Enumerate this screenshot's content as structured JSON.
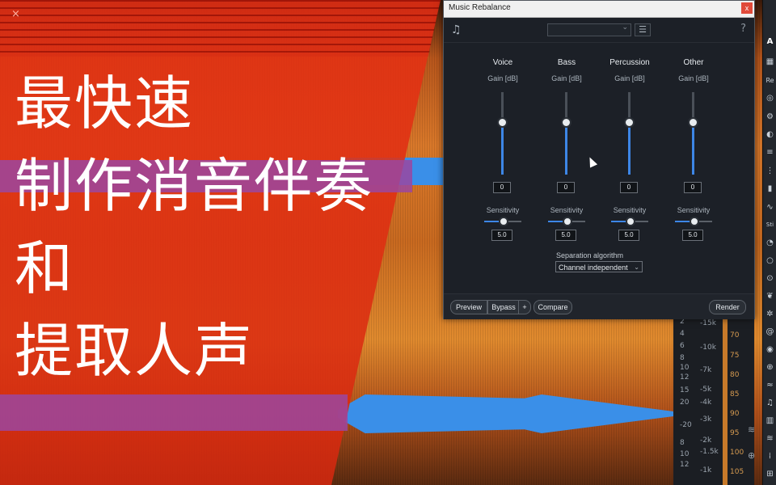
{
  "overlay": {
    "close_glyph": "×",
    "title_lines": [
      "最快速",
      "制作消音伴奏",
      "和",
      "提取人声"
    ],
    "accent_color": "#e63214",
    "band_color": "#9b46a0"
  },
  "plugin": {
    "window_title": "Music Rebalance",
    "close_glyph": "x",
    "preset_value": "",
    "help_glyph": "?",
    "channels": [
      {
        "name": "Voice",
        "unit": "Gain [dB]",
        "gain": "0",
        "sensitivity_label": "Sensitivity",
        "sensitivity": "5.0"
      },
      {
        "name": "Bass",
        "unit": "Gain [dB]",
        "gain": "0",
        "sensitivity_label": "Sensitivity",
        "sensitivity": "5.0"
      },
      {
        "name": "Percussion",
        "unit": "Gain [dB]",
        "gain": "0",
        "sensitivity_label": "Sensitivity",
        "sensitivity": "5.0"
      },
      {
        "name": "Other",
        "unit": "Gain [dB]",
        "gain": "0",
        "sensitivity_label": "Sensitivity",
        "sensitivity": "5.0"
      }
    ],
    "separation_label": "Separation algorithm",
    "separation_value": "Channel independent",
    "buttons": {
      "preview": "Preview",
      "bypass": "Bypass",
      "plus": "+",
      "compare": "Compare",
      "render": "Render"
    },
    "accent_color": "#3d86e6"
  },
  "scale": {
    "db_ticks": [
      "2",
      "4",
      "6",
      "8",
      "10",
      "12",
      "15",
      "20",
      "-20",
      "8",
      "10",
      "12"
    ],
    "hz_ticks": [
      "-15k",
      "-10k",
      "-7k",
      "-5k",
      "-4k",
      "-3k",
      "-2k",
      "-1.5k",
      "-1k"
    ],
    "meter_ticks": [
      "70",
      "75",
      "80",
      "85",
      "90",
      "95",
      "100",
      "105"
    ]
  },
  "toolstrip": {
    "label_a": "A",
    "label_re": "Re",
    "label_sti": "Sti"
  }
}
